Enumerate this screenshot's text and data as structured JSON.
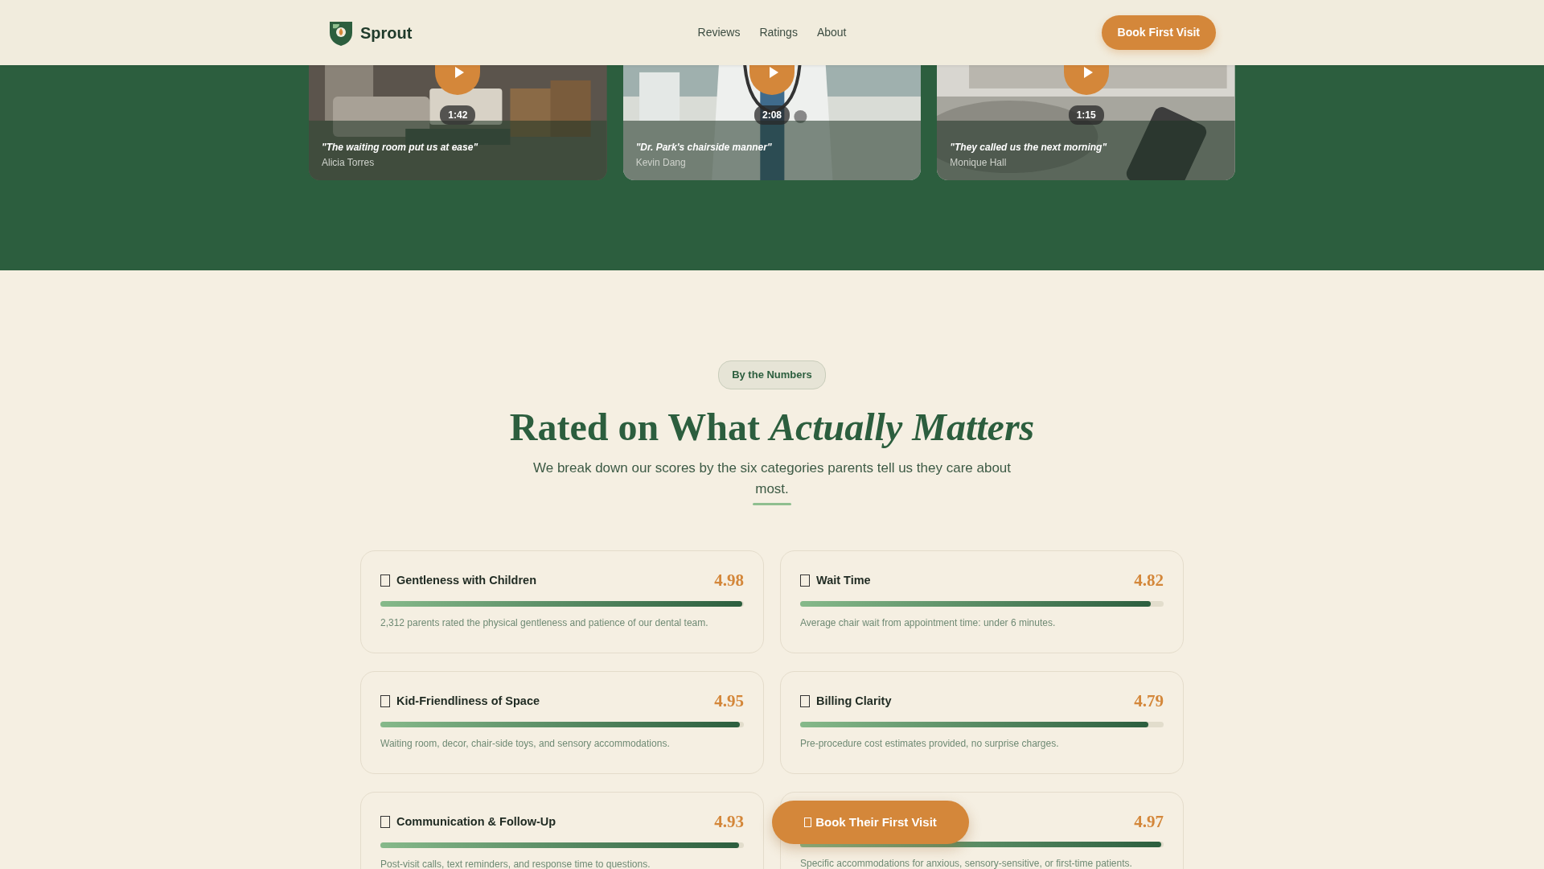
{
  "header": {
    "brand": "Sprout",
    "nav": [
      {
        "label": "Reviews"
      },
      {
        "label": "Ratings"
      },
      {
        "label": "About"
      }
    ],
    "cta": "Book First Visit"
  },
  "videos": [
    {
      "duration": "1:42",
      "quote": "\"The waiting room put us at ease\"",
      "author": "Alicia Torres"
    },
    {
      "duration": "2:08",
      "quote": "\"Dr. Park's chairside manner\"",
      "author": "Kevin Dang"
    },
    {
      "duration": "1:15",
      "quote": "\"They called us the next morning\"",
      "author": "Monique Hall"
    }
  ],
  "section": {
    "tag": "By the Numbers",
    "title": "Rated on What *Actually Matters*",
    "subtitle": "We break down our scores by the six categories parents tell us they care about most."
  },
  "ratings": [
    {
      "title": "Gentleness with Children",
      "score": "4.98",
      "level": 0.996,
      "description": "2,312 parents rated the physical gentleness and patience of our dental team."
    },
    {
      "title": "Wait Time",
      "score": "4.82",
      "level": 0.964,
      "description": "Average chair wait from appointment time: under 6 minutes."
    },
    {
      "title": "Kid-Friendliness of Space",
      "score": "4.95",
      "level": 0.99,
      "description": "Waiting room, decor, chair-side toys, and sensory accommodations."
    },
    {
      "title": "Billing Clarity",
      "score": "4.79",
      "level": 0.958,
      "description": "Pre-procedure cost estimates provided, no surprise charges."
    },
    {
      "title": "Communication & Follow-Up",
      "score": "4.93",
      "level": 0.986,
      "description": "Post-visit calls, text reminders, and response time to questions."
    },
    {
      "score": "4.97",
      "level": 0.994,
      "description": "Specific accommodations for anxious, sensory-sensitive, or first-time patients."
    }
  ],
  "floating_button": "Book Their First Visit"
}
